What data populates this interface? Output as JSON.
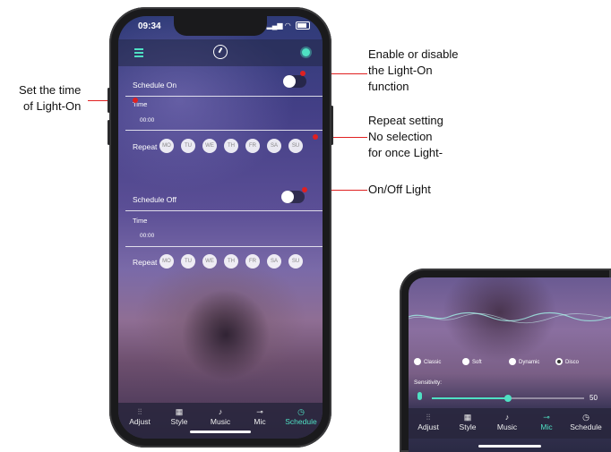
{
  "annotations": {
    "enable_lines": [
      "Enable or disable",
      "the Light-On",
      "function"
    ],
    "set_time_lines": [
      "Set the time",
      "of Light-On"
    ],
    "repeat_lines": [
      "Repeat setting",
      "No selection",
      "for once Light-"
    ],
    "onoff_line": "On/Off Light"
  },
  "phone": {
    "status_time": "09:34",
    "schedule_on": {
      "label": "Schedule On",
      "time_label": "Time",
      "time_value": "00:00",
      "repeat_label": "Repeat",
      "days": [
        "MO",
        "TU",
        "WE",
        "TH",
        "FR",
        "SA",
        "SU"
      ]
    },
    "schedule_off": {
      "label": "Schedule Off",
      "time_label": "Time",
      "time_value": "00:00",
      "repeat_label": "Repeat",
      "days": [
        "MO",
        "TU",
        "WE",
        "TH",
        "FR",
        "SA",
        "SU"
      ]
    },
    "tabs": [
      {
        "label": "Adjust",
        "icon": "sliders-icon"
      },
      {
        "label": "Style",
        "icon": "grid-icon"
      },
      {
        "label": "Music",
        "icon": "music-note-icon"
      },
      {
        "label": "Mic",
        "icon": "mic-icon"
      },
      {
        "label": "Schedule",
        "icon": "timer-icon"
      }
    ],
    "accent_color": "#4fe0c3"
  },
  "phone2": {
    "modes": [
      {
        "label": "Classic",
        "selected": false
      },
      {
        "label": "Soft",
        "selected": false
      },
      {
        "label": "Dynamic",
        "selected": false
      },
      {
        "label": "Disco",
        "selected": true
      }
    ],
    "sensitivity_label": "Sensitivity:",
    "sensitivity_value": "50",
    "tabs": [
      {
        "label": "Adjust",
        "icon": "sliders-icon"
      },
      {
        "label": "Style",
        "icon": "grid-icon"
      },
      {
        "label": "Music",
        "icon": "music-note-icon"
      },
      {
        "label": "Mic",
        "icon": "mic-icon"
      },
      {
        "label": "Schedule",
        "icon": "timer-icon"
      }
    ]
  }
}
